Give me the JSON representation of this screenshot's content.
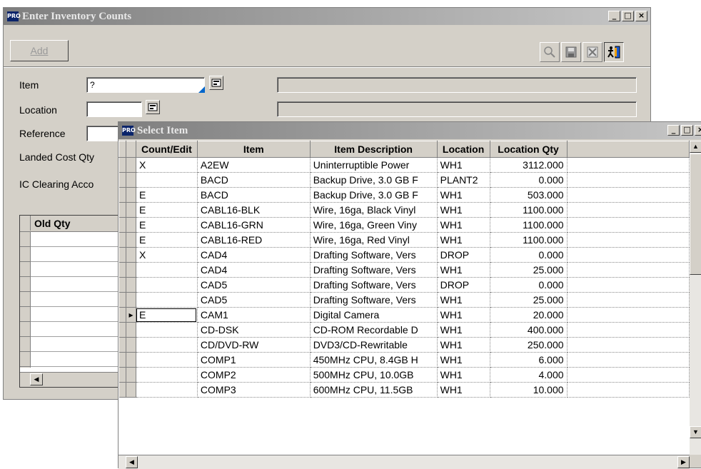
{
  "main_window": {
    "title": "Enter Inventory Counts",
    "title_icon": "PRO",
    "add_label": "Add",
    "fields": {
      "item_label": "Item",
      "item_value": "?",
      "location_label": "Location",
      "reference_label": "Reference",
      "landed_cost_label": "Landed Cost Qty",
      "ic_clearing_label": "IC Clearing Acco"
    },
    "grid_header": "Old Qty"
  },
  "select_dialog": {
    "title": "Select Item",
    "title_icon": "PRO",
    "columns": [
      "Count/Edit",
      "Item",
      "Item Description",
      "Location",
      "Location Qty"
    ],
    "rows": [
      {
        "count_edit": "X",
        "item": "A2EW",
        "description": "Uninterruptible Power",
        "location": "WH1",
        "qty": "3112.000"
      },
      {
        "count_edit": "",
        "item": "BACD",
        "description": "Backup Drive, 3.0 GB F",
        "location": "PLANT2",
        "qty": "0.000"
      },
      {
        "count_edit": "E",
        "item": "BACD",
        "description": "Backup Drive, 3.0 GB F",
        "location": "WH1",
        "qty": "503.000"
      },
      {
        "count_edit": "E",
        "item": "CABL16-BLK",
        "description": "Wire, 16ga, Black Vinyl",
        "location": "WH1",
        "qty": "1100.000"
      },
      {
        "count_edit": "E",
        "item": "CABL16-GRN",
        "description": "Wire, 16ga, Green Viny",
        "location": "WH1",
        "qty": "1100.000"
      },
      {
        "count_edit": "E",
        "item": "CABL16-RED",
        "description": "Wire, 16ga, Red Vinyl",
        "location": "WH1",
        "qty": "1100.000"
      },
      {
        "count_edit": "X",
        "item": "CAD4",
        "description": "Drafting Software, Vers",
        "location": "DROP",
        "qty": "0.000"
      },
      {
        "count_edit": "",
        "item": "CAD4",
        "description": "Drafting Software, Vers",
        "location": "WH1",
        "qty": "25.000"
      },
      {
        "count_edit": "",
        "item": "CAD5",
        "description": "Drafting Software, Vers",
        "location": "DROP",
        "qty": "0.000"
      },
      {
        "count_edit": "",
        "item": "CAD5",
        "description": "Drafting Software, Vers",
        "location": "WH1",
        "qty": "25.000"
      },
      {
        "count_edit": "E",
        "item": "CAM1",
        "description": "Digital Camera",
        "location": "WH1",
        "qty": "20.000"
      },
      {
        "count_edit": "",
        "item": "CD-DSK",
        "description": "CD-ROM Recordable D",
        "location": "WH1",
        "qty": "400.000"
      },
      {
        "count_edit": "",
        "item": "CD/DVD-RW",
        "description": "DVD3/CD-Rewritable",
        "location": "WH1",
        "qty": "250.000"
      },
      {
        "count_edit": "",
        "item": "COMP1",
        "description": "450MHz CPU, 8.4GB H",
        "location": "WH1",
        "qty": "6.000"
      },
      {
        "count_edit": "",
        "item": "COMP2",
        "description": "500MHz CPU, 10.0GB",
        "location": "WH1",
        "qty": "4.000"
      },
      {
        "count_edit": "",
        "item": "COMP3",
        "description": "600MHz CPU, 11.5GB",
        "location": "WH1",
        "qty": "10.000"
      }
    ],
    "current_row_index": 10
  },
  "colors": {
    "title_gradient_start": "#7f7f7f",
    "face": "#d4d0c8",
    "app_icon": "#0a246a"
  }
}
